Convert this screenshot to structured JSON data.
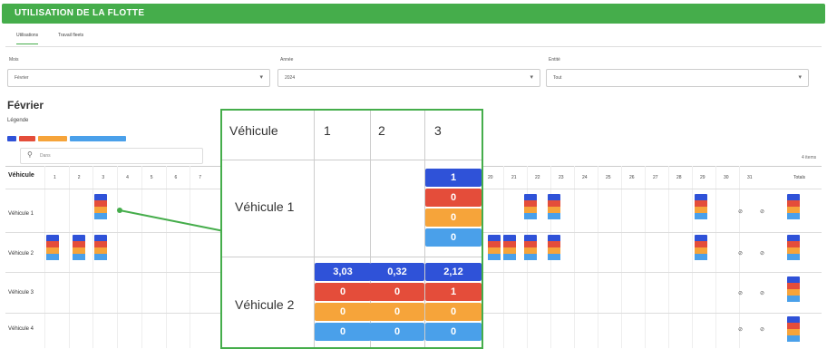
{
  "header": {
    "title": "UTILISATION DE LA FLOTTE"
  },
  "tabs": [
    {
      "label": "Utilisations"
    },
    {
      "label": "Travail fleets"
    }
  ],
  "filters": [
    {
      "label": "Mois",
      "value": "Février"
    },
    {
      "label": "Année",
      "value": "2024"
    },
    {
      "label": "Entité",
      "value": "Tout"
    }
  ],
  "month_title": "Février",
  "legend_title": "Légende",
  "colors": {
    "accent": "#45ad4b",
    "blue": "#2f52d8",
    "red": "#e44d3a",
    "orange": "#f6a43a",
    "light_blue": "#4aa0ea"
  },
  "search_placeholder": "Dans",
  "items_count": "4 items",
  "table": {
    "vehicle_header": "Véhicule",
    "day_headers": [
      "1",
      "2",
      "3",
      "4",
      "5",
      "6",
      "7",
      "",
      "",
      "",
      "",
      "",
      "",
      "",
      "",
      "",
      "",
      "",
      "",
      "20",
      "21",
      "22",
      "23",
      "24",
      "25",
      "26",
      "27",
      "28",
      "29",
      "30",
      "31",
      "Totals"
    ],
    "rows": [
      "Véhicule 1",
      "Véhicule 2",
      "Véhicule 3",
      "Véhicule 4"
    ],
    "blocked_symbol": "⊘"
  },
  "zoom": {
    "vehicle_header": "Véhicule",
    "day_headers": [
      "1",
      "2",
      "3"
    ],
    "rows": [
      {
        "label": "Véhicule 1",
        "day3": [
          "1",
          "0",
          "0",
          "0"
        ]
      },
      {
        "label": "Véhicule 2",
        "day1": [
          "3,03",
          "0",
          "0",
          "0"
        ],
        "day2": [
          "0,32",
          "0",
          "0",
          "0"
        ],
        "day3": [
          "2,12",
          "1",
          "0",
          "0"
        ]
      }
    ]
  }
}
